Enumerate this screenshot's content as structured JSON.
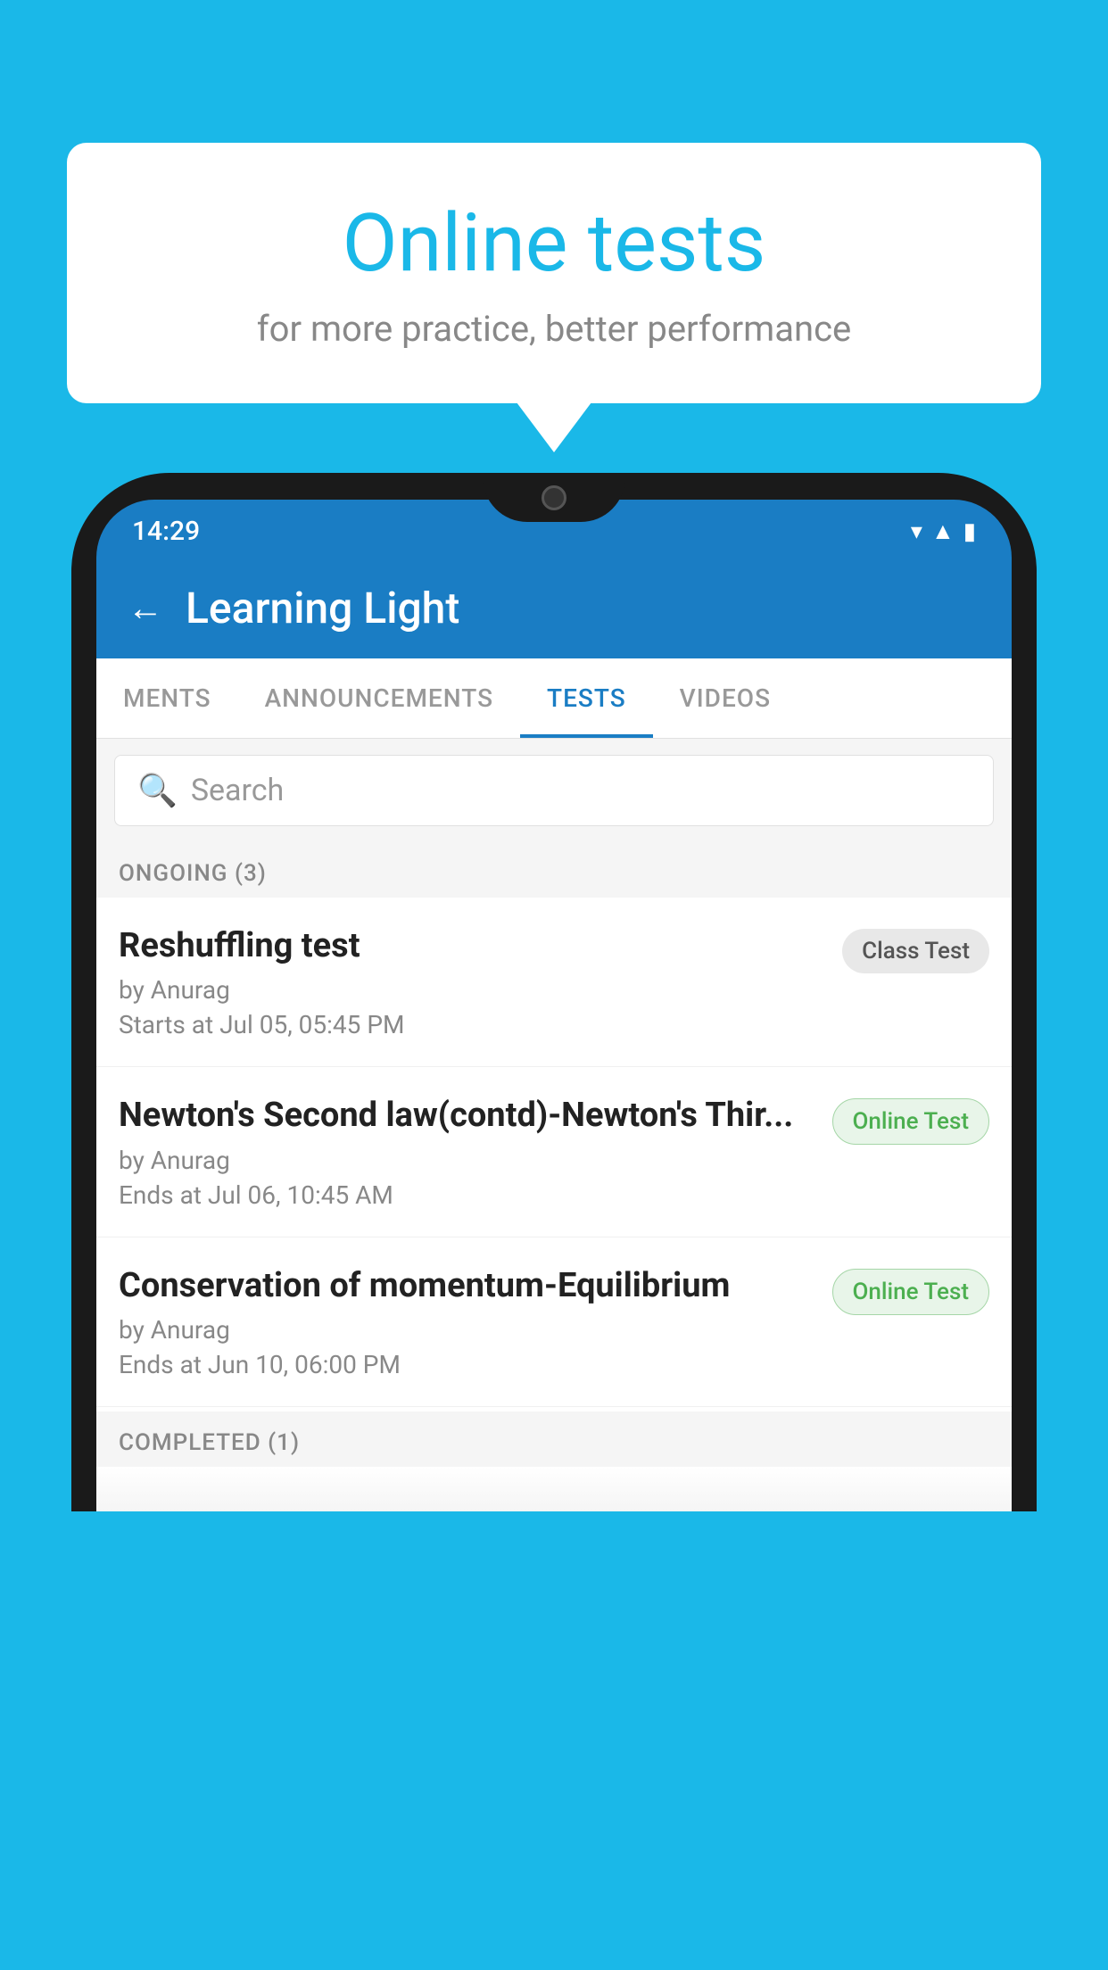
{
  "background": {
    "color": "#1ab8e8"
  },
  "speech_bubble": {
    "title": "Online tests",
    "subtitle": "for more practice, better performance"
  },
  "phone": {
    "status_bar": {
      "time": "14:29",
      "icons": [
        "wifi",
        "signal",
        "battery"
      ]
    },
    "app_bar": {
      "title": "Learning Light",
      "back_label": "←"
    },
    "tabs": [
      {
        "label": "MENTS",
        "active": false
      },
      {
        "label": "ANNOUNCEMENTS",
        "active": false
      },
      {
        "label": "TESTS",
        "active": true
      },
      {
        "label": "VIDEOS",
        "active": false
      }
    ],
    "search": {
      "placeholder": "Search"
    },
    "ongoing_section": {
      "title": "ONGOING (3)",
      "items": [
        {
          "name": "Reshuffling test",
          "author": "by Anurag",
          "date": "Starts at  Jul 05, 05:45 PM",
          "badge": "Class Test",
          "badge_type": "class"
        },
        {
          "name": "Newton's Second law(contd)-Newton's Thir...",
          "author": "by Anurag",
          "date": "Ends at  Jul 06, 10:45 AM",
          "badge": "Online Test",
          "badge_type": "online"
        },
        {
          "name": "Conservation of momentum-Equilibrium",
          "author": "by Anurag",
          "date": "Ends at  Jun 10, 06:00 PM",
          "badge": "Online Test",
          "badge_type": "online"
        }
      ]
    },
    "completed_section": {
      "title": "COMPLETED (1)"
    }
  }
}
